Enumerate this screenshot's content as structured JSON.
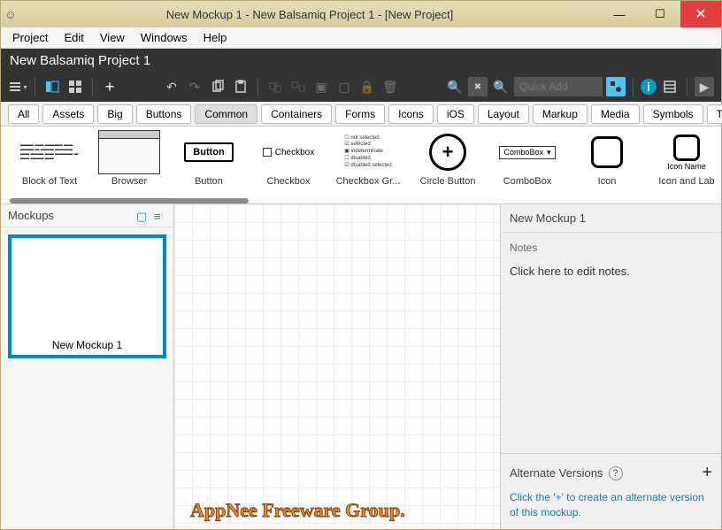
{
  "window": {
    "title": "New Mockup 1 - New Balsamiq Project 1 - [New Project]"
  },
  "menubar": [
    "Project",
    "Edit",
    "View",
    "Windows",
    "Help"
  ],
  "project_title": "New Balsamiq Project 1",
  "quick_add_placeholder": "Quick Add",
  "category_tabs": [
    "All",
    "Assets",
    "Big",
    "Buttons",
    "Common",
    "Containers",
    "Forms",
    "Icons",
    "iOS",
    "Layout",
    "Markup",
    "Media",
    "Symbols",
    "Text"
  ],
  "category_active": "Common",
  "library": [
    {
      "label": "Block of Text"
    },
    {
      "label": "Browser"
    },
    {
      "label": "Button",
      "sample": "Button"
    },
    {
      "label": "Checkbox",
      "sample": "Checkbox"
    },
    {
      "label": "Checkbox Gr..."
    },
    {
      "label": "Circle Button"
    },
    {
      "label": "ComboBox",
      "sample": "ComboBox"
    },
    {
      "label": "Icon"
    },
    {
      "label": "Icon and Lab",
      "sample": "Icon Name"
    }
  ],
  "sidebar": {
    "title": "Mockups",
    "items": [
      {
        "label": "New Mockup 1"
      }
    ]
  },
  "inspector": {
    "title": "New Mockup 1",
    "notes_label": "Notes",
    "notes_placeholder": "Click here to edit notes.",
    "alternates_label": "Alternate Versions",
    "alternates_hint": "Click the '+' to create an alternate version of this mockup."
  },
  "watermark": "AppNee Freeware Group."
}
